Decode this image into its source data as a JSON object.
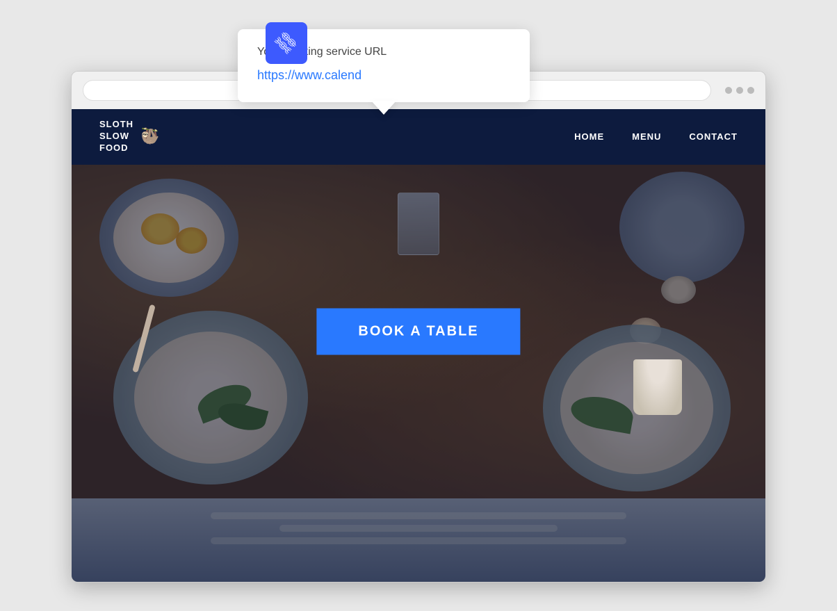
{
  "page": {
    "background_color": "#e2e2e2"
  },
  "tooltip": {
    "label": "Your Booking service URL",
    "input_value": "https://www.calend",
    "input_placeholder": "https://www.calend"
  },
  "link_badge": {
    "icon": "🔗"
  },
  "browser": {
    "address_bar_placeholder": "",
    "dots": [
      "dot1",
      "dot2",
      "dot3"
    ]
  },
  "nav": {
    "logo_line1": "SLOTH",
    "logo_line2": "SLOW",
    "logo_line3": "FOOD",
    "logo_icon": "🦥",
    "links": [
      {
        "label": "HOME",
        "href": "#"
      },
      {
        "label": "MENU",
        "href": "#"
      },
      {
        "label": "CONTACT",
        "href": "#"
      }
    ]
  },
  "hero": {
    "book_button_label": "BOOK A TABLE"
  }
}
